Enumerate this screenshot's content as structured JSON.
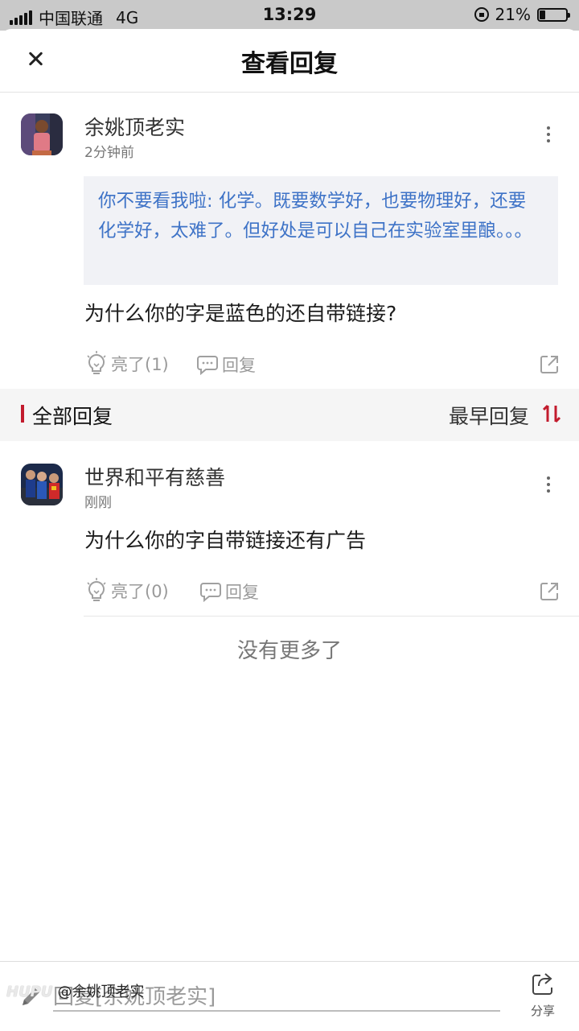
{
  "status_bar": {
    "carrier": "中国联通",
    "network": "4G",
    "time": "13:29",
    "battery": "21%",
    "battery_level": 0.21
  },
  "header": {
    "title": "查看回复",
    "close_icon": "close-icon"
  },
  "original_post": {
    "username": "余姚顶老实",
    "time": "2分钟前",
    "quote": "你不要看我啦: 化学。既要数学好，也要物理好，还要化学好，太难了。但好处是可以自己在实验室里酿。。。",
    "content": "为什么你的字是蓝色的还自带链接?",
    "actions": {
      "like_label": "亮了(1)",
      "reply_label": "回复"
    }
  },
  "section": {
    "title": "全部回复",
    "sort_label": "最早回复",
    "accent": "#c21b2d"
  },
  "replies": [
    {
      "username": "世界和平有慈善",
      "time": "刚刚",
      "content": "为什么你的字自带链接还有广告",
      "like_label": "亮了(0)",
      "reply_label": "回复"
    }
  ],
  "end_text": "没有更多了",
  "bottom_bar": {
    "placeholder": "回复[余姚顶老实]",
    "share_label": "分享"
  },
  "watermark": {
    "brand": "HUPU",
    "handle": "@余姚顶老实"
  },
  "colors": {
    "quote_text": "#3e73c7",
    "quote_bg": "#f1f2f6"
  }
}
